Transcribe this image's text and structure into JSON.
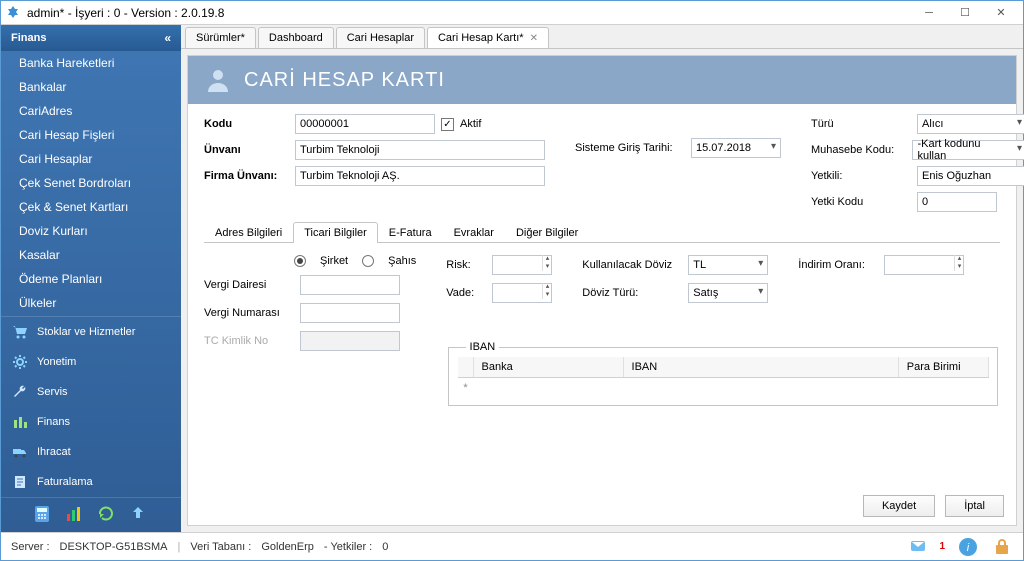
{
  "window": {
    "title": "admin* - İşyeri : 0 - Version : 2.0.19.8"
  },
  "sidebar": {
    "active_panel": "Finans",
    "tree": [
      "Banka Hareketleri",
      "Bankalar",
      "CariAdres",
      "Cari Hesap Fişleri",
      "Cari Hesaplar",
      "Çek Senet Bordroları",
      "Çek & Senet Kartları",
      "Doviz Kurları",
      "Kasalar",
      "Ödeme Planları",
      "Ülkeler"
    ],
    "modules": [
      {
        "label": "Stoklar ve Hizmetler",
        "icon": "cart"
      },
      {
        "label": "Yonetim",
        "icon": "gear"
      },
      {
        "label": "Servis",
        "icon": "wrench"
      },
      {
        "label": "Finans",
        "icon": "finance"
      },
      {
        "label": "Ihracat",
        "icon": "truck"
      },
      {
        "label": "Faturalama",
        "icon": "invoice"
      }
    ]
  },
  "tabs": [
    {
      "label": "Sürümler*",
      "active": false
    },
    {
      "label": "Dashboard",
      "active": false
    },
    {
      "label": "Cari Hesaplar",
      "active": false
    },
    {
      "label": "Cari Hesap Kartı*",
      "active": true,
      "closable": true
    }
  ],
  "page": {
    "title": "CARİ HESAP KARTI",
    "fields": {
      "kodu_label": "Kodu",
      "kodu_value": "00000001",
      "aktif_label": "Aktif",
      "aktif_checked": true,
      "unvani_label": "Ünvanı",
      "unvani_value": "Turbim Teknoloji",
      "firma_unvani_label": "Firma Ünvanı:",
      "firma_unvani_value": "Turbim Teknoloji AŞ.",
      "sisteme_giris_label": "Sisteme Giriş Tarihi:",
      "sisteme_giris_value": "15.07.2018",
      "turu_label": "Türü",
      "turu_value": "Alıcı",
      "muhasebe_kodu_label": "Muhasebe Kodu:",
      "muhasebe_kodu_value": "-Kart kodunu kullan",
      "yetkili_label": "Yetkili:",
      "yetkili_value": "Enis Oğuzhan",
      "yetki_kodu_label": "Yetki Kodu",
      "yetki_kodu_value": "0"
    },
    "sub_tabs": [
      "Adres Bilgileri",
      "Ticari Bilgiler",
      "E-Fatura",
      "Evraklar",
      "Diğer Bilgiler"
    ],
    "active_sub_tab": 1,
    "ticari": {
      "sirket_label": "Şirket",
      "sahis_label": "Şahıs",
      "vergi_dairesi_label": "Vergi Dairesi",
      "vergi_dairesi_value": "",
      "vergi_numarasi_label": "Vergi Numarası",
      "vergi_numarasi_value": "",
      "tc_kimlik_label": "TC Kimlik No",
      "tc_kimlik_value": "",
      "risk_label": "Risk:",
      "risk_value": "",
      "vade_label": "Vade:",
      "vade_value": "",
      "kullanilacak_doviz_label": "Kullanılacak Döviz",
      "kullanilacak_doviz_value": "TL",
      "doviz_turu_label": "Döviz Türü:",
      "doviz_turu_value": "Satış",
      "indirim_label": "İndirim Oranı:",
      "indirim_value": "",
      "iban_legend": "IBAN",
      "iban_columns": {
        "banka": "Banka",
        "iban": "IBAN",
        "para": "Para Birimi"
      }
    },
    "buttons": {
      "save": "Kaydet",
      "cancel": "İptal"
    }
  },
  "status": {
    "server_label": "Server : ",
    "server": "DESKTOP-G51BSMA",
    "db_label": "Veri Tabanı : ",
    "db": "GoldenErp",
    "yetki_label": "- Yetkiler : ",
    "yetki": "0",
    "msg_count": "1"
  }
}
